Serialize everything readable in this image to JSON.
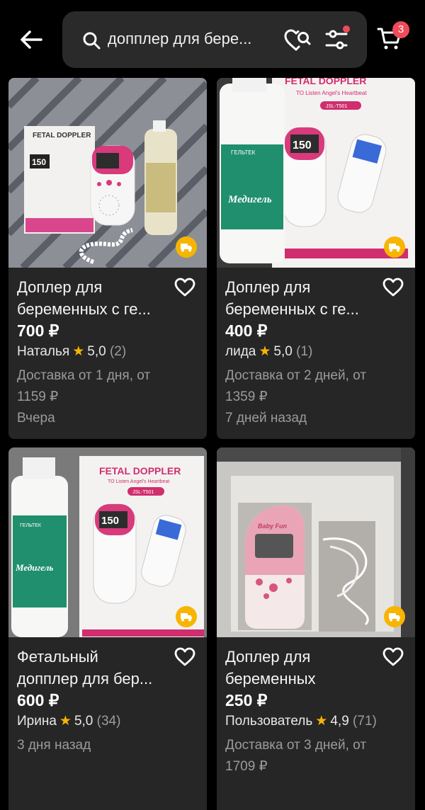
{
  "search": {
    "query": "допплер для бере..."
  },
  "cart": {
    "count": "3"
  },
  "products": [
    {
      "title1": "Доплер для",
      "title2": "беременных с ге...",
      "price": "700 ₽",
      "seller": "Наталья",
      "rating": "5,0",
      "reviews": "(2)",
      "delivery1": "Доставка от 1 дня, от",
      "delivery2": "1159 ₽",
      "date": "Вчера",
      "image_text": {
        "brand": "FETAL DOPPLER",
        "reading": "150"
      }
    },
    {
      "title1": "Доплер для",
      "title2": "беременных с ге...",
      "price": "400 ₽",
      "seller": "лида",
      "rating": "5,0",
      "reviews": "(1)",
      "delivery1": "Доставка от 2 дней, от",
      "delivery2": "1359 ₽",
      "date": "7 дней назад",
      "image_text": {
        "brand": "FETAL DOPPLER",
        "subtitle": "TO Listen Angel's Heartbeat",
        "model": "JSL-T501",
        "bottle_brand": "ГЕЛЬТЕК",
        "bottle_name": "Медигель",
        "reading": "150"
      }
    },
    {
      "title1": "Фетальный",
      "title2": "допплер для бер...",
      "price": "600 ₽",
      "seller": "Ирина",
      "rating": "5,0",
      "reviews": "(34)",
      "delivery1": "3 дня назад",
      "delivery2": "",
      "date": "",
      "image_text": {
        "brand": "FETAL DOPPLER",
        "subtitle": "TO Listen Angel's Heartbeat",
        "model": "JSL-T501",
        "bottle_brand": "ГЕЛЬТЕК",
        "bottle_name": "Медигель",
        "reading": "150"
      }
    },
    {
      "title1": "Доплер для",
      "title2": "беременных",
      "price": "250 ₽",
      "seller": "Пользователь",
      "rating": "4,9",
      "reviews": "(71)",
      "delivery1": "Доставка от 3 дней, от",
      "delivery2": "1709 ₽",
      "date": "",
      "image_text": {
        "brand": "Baby Fun"
      }
    }
  ],
  "colors": {
    "accent": "#ef4b5a",
    "star": "#f7b500",
    "card_bg": "#262626",
    "muted": "#9b9b9b"
  }
}
